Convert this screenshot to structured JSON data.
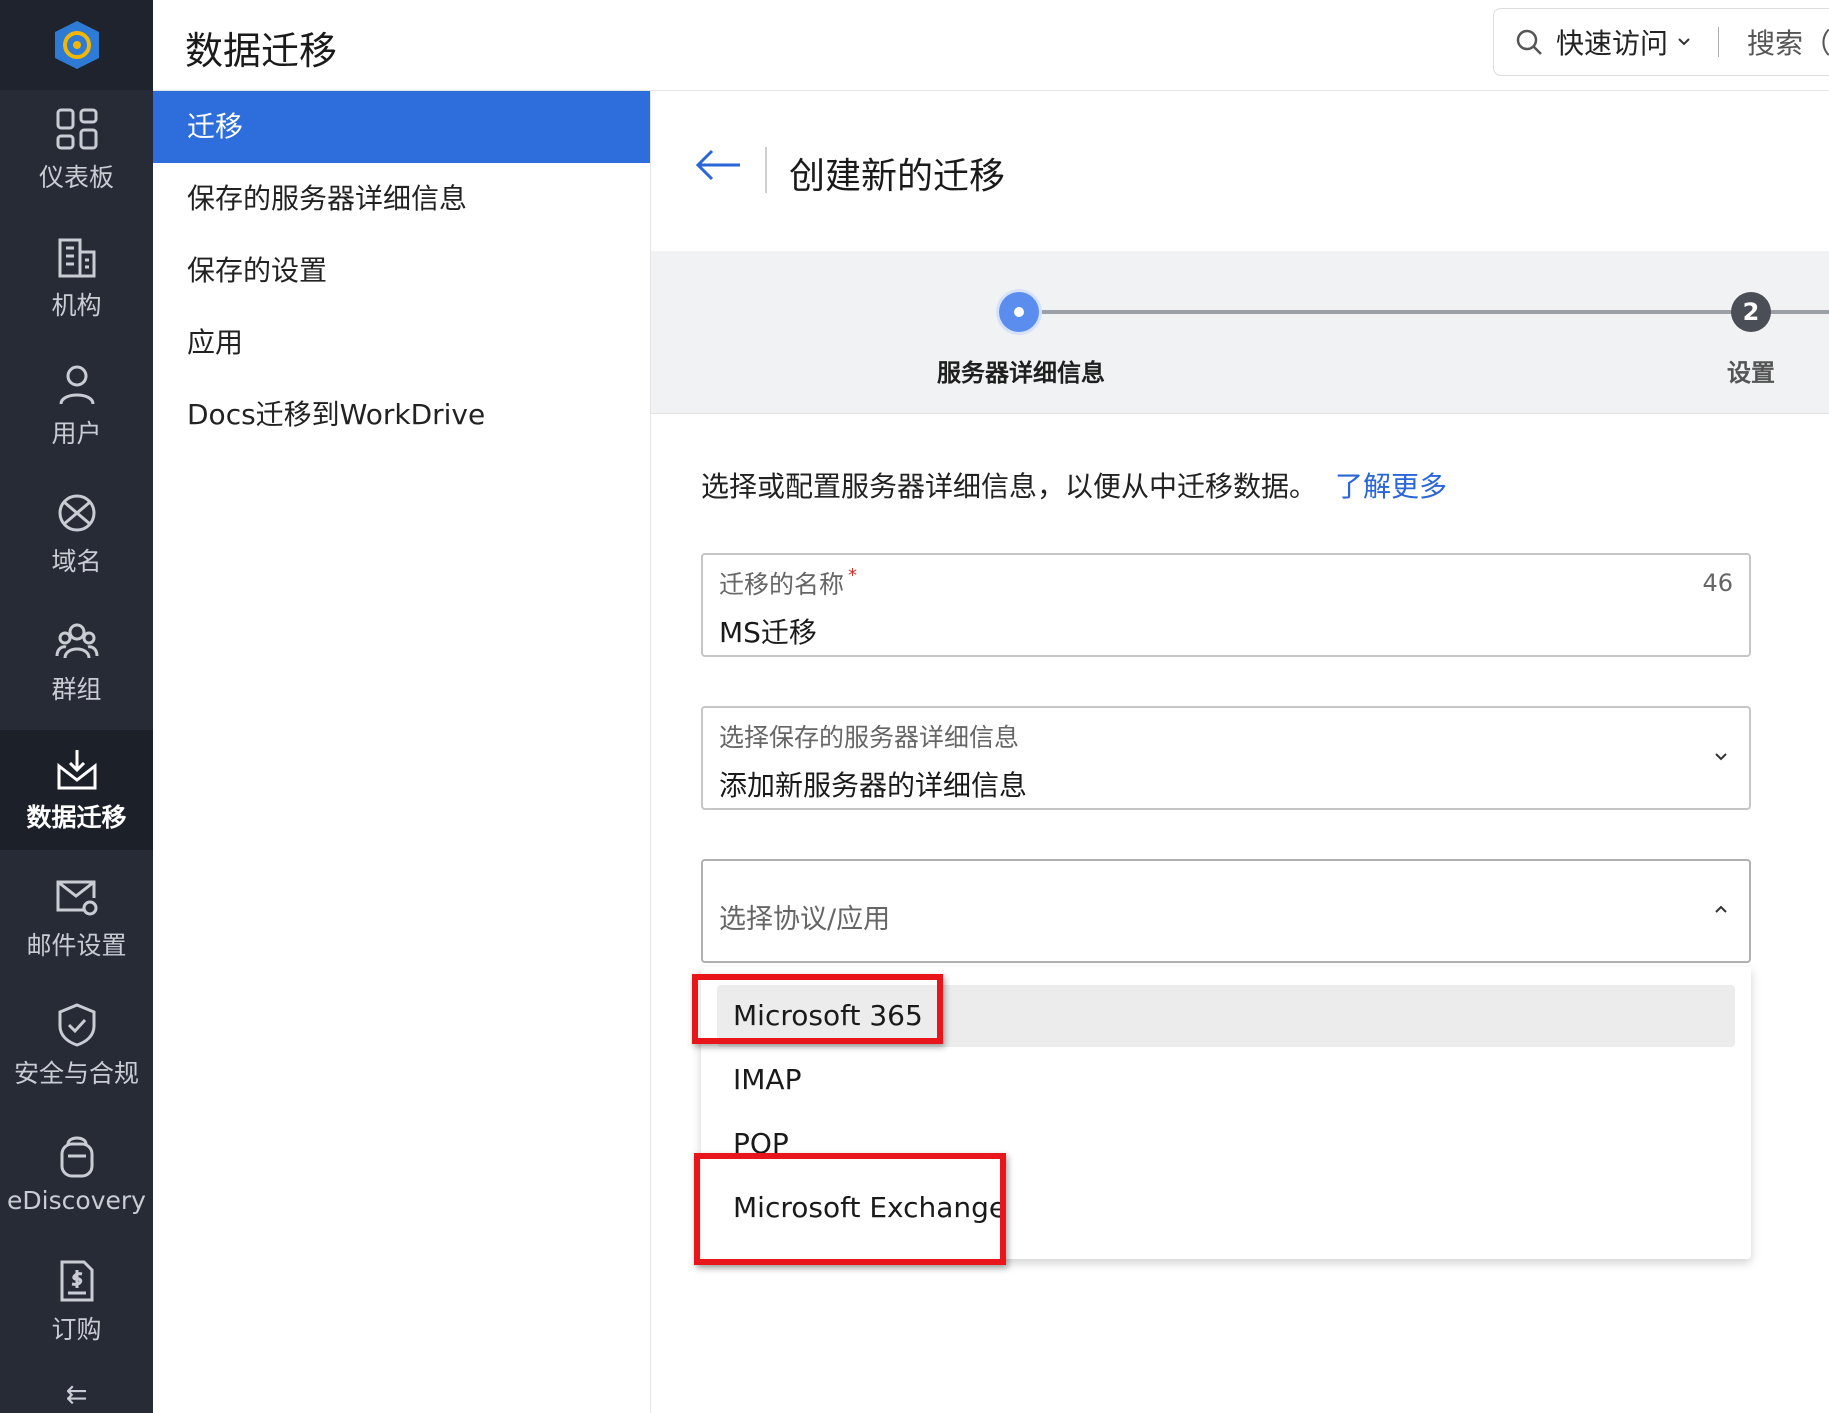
{
  "header": {
    "title": "数据迁移",
    "quick_access_label": "快速访问",
    "search_label": "搜索（"
  },
  "rail": {
    "items": [
      {
        "label": "仪表板",
        "icon": "dashboard-icon"
      },
      {
        "label": "机构",
        "icon": "building-icon"
      },
      {
        "label": "用户",
        "icon": "user-icon"
      },
      {
        "label": "域名",
        "icon": "globe-icon"
      },
      {
        "label": "群组",
        "icon": "group-icon"
      },
      {
        "label": "数据迁移",
        "icon": "data-migration-icon",
        "active": true
      },
      {
        "label": "邮件设置",
        "icon": "mail-settings-icon"
      },
      {
        "label": "安全与合规",
        "icon": "shield-icon"
      },
      {
        "label": "eDiscovery",
        "icon": "ediscovery-icon"
      },
      {
        "label": "订购",
        "icon": "subscription-icon"
      }
    ]
  },
  "subnav": {
    "items": [
      {
        "label": "迁移",
        "active": true
      },
      {
        "label": "保存的服务器详细信息"
      },
      {
        "label": "保存的设置"
      },
      {
        "label": "应用"
      },
      {
        "label": "Docs迁移到WorkDrive"
      }
    ]
  },
  "main": {
    "form_title": "创建新的迁移",
    "steps": [
      {
        "label": "服务器详细信息",
        "state": "current"
      },
      {
        "label": "设置",
        "number": "2"
      }
    ],
    "intro_text": "选择或配置服务器详细信息，以便从中迁移数据。",
    "learn_more": "了解更多",
    "name_field": {
      "label": "迁移的名称",
      "required_mark": "*",
      "value": "MS迁移",
      "counter": "46"
    },
    "saved_server_field": {
      "label": "选择保存的服务器详细信息",
      "value": "添加新服务器的详细信息"
    },
    "protocol_field": {
      "placeholder": "选择协议/应用"
    },
    "protocol_options": [
      "Microsoft 365",
      "IMAP",
      "POP",
      "Microsoft Exchange"
    ]
  },
  "colors": {
    "rail_bg": "#262b36",
    "accent": "#2e6ddc",
    "highlight_box": "#e8161b"
  }
}
